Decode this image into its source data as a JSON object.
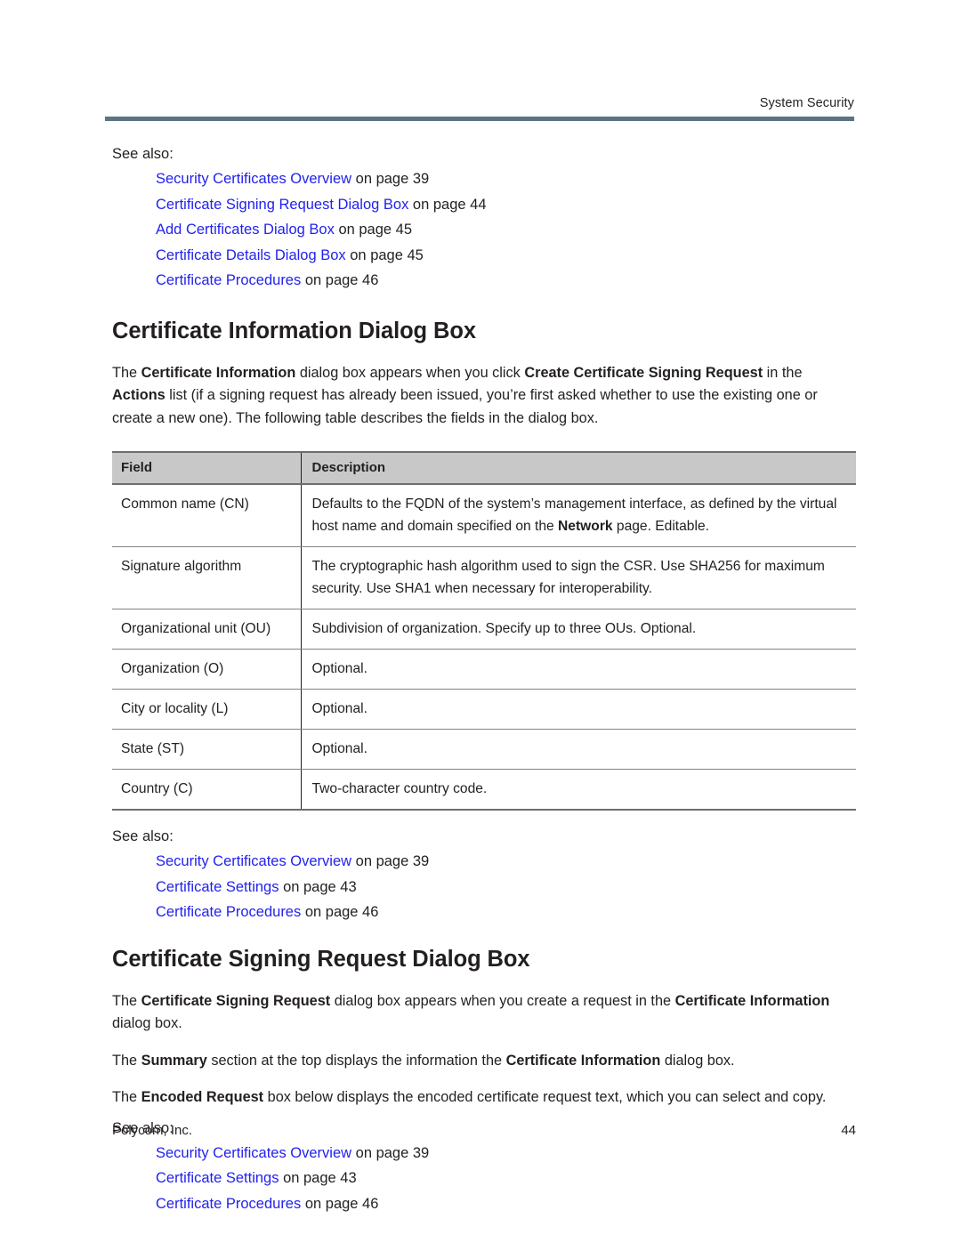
{
  "running_header": {
    "title": "System Security"
  },
  "see_also_1": {
    "label": "See also:",
    "items": [
      {
        "link": "Security Certificates Overview",
        "tail": " on page 39"
      },
      {
        "link": "Certificate Signing Request Dialog Box",
        "tail": " on page 44"
      },
      {
        "link": "Add Certificates Dialog Box",
        "tail": " on page 45"
      },
      {
        "link": "Certificate Details Dialog Box",
        "tail": " on page 45"
      },
      {
        "link": "Certificate Procedures",
        "tail": " on page 46"
      }
    ]
  },
  "section_1": {
    "heading": "Certificate Information Dialog Box",
    "intro": {
      "p1": "The ",
      "b1": "Certificate Information",
      "p2": " dialog box appears when you click ",
      "b2": "Create Certificate Signing Request",
      "p3": " in the ",
      "b3": "Actions",
      "p4": " list (if a signing request has already been issued, you’re first asked whether to use the existing one or create a new one). The following table describes the fields in the dialog box."
    }
  },
  "table": {
    "columns": [
      "Field",
      "Description"
    ],
    "rows": [
      {
        "field": "Common name (CN)",
        "desc_pre": "Defaults to the FQDN of the system’s management interface, as defined by the virtual host name and domain specified on the ",
        "desc_bold": "Network",
        "desc_post": " page. Editable."
      },
      {
        "field": "Signature algorithm",
        "desc_pre": "The cryptographic hash algorithm used to sign the CSR. Use SHA256 for maximum security. Use SHA1 when necessary for interoperability.",
        "desc_bold": "",
        "desc_post": ""
      },
      {
        "field": "Organizational unit (OU)",
        "desc_pre": "Subdivision of organization. Specify up to three OUs. Optional.",
        "desc_bold": "",
        "desc_post": ""
      },
      {
        "field": "Organization (O)",
        "desc_pre": "Optional.",
        "desc_bold": "",
        "desc_post": ""
      },
      {
        "field": "City or locality (L)",
        "desc_pre": "Optional.",
        "desc_bold": "",
        "desc_post": ""
      },
      {
        "field": "State (ST)",
        "desc_pre": "Optional.",
        "desc_bold": "",
        "desc_post": ""
      },
      {
        "field": "Country (C)",
        "desc_pre": "Two-character country code.",
        "desc_bold": "",
        "desc_post": ""
      }
    ]
  },
  "see_also_2": {
    "label": "See also:",
    "items": [
      {
        "link": "Security Certificates Overview",
        "tail": " on page 39"
      },
      {
        "link": "Certificate Settings",
        "tail": " on page 43"
      },
      {
        "link": "Certificate Procedures",
        "tail": " on page 46"
      }
    ]
  },
  "section_2": {
    "heading": "Certificate Signing Request Dialog Box",
    "para1": {
      "t1": "The ",
      "b1": "Certificate Signing Request",
      "t2": " dialog box appears when you create a request in the ",
      "b2": "Certificate Information",
      "t3": " dialog box."
    },
    "para2": {
      "t1": "The ",
      "b1": "Summary",
      "t2": " section at the top displays the information the ",
      "b2": "Certificate Information",
      "t3": " dialog box."
    },
    "para3": {
      "t1": "The ",
      "b1": "Encoded Request",
      "t2": " box below displays the encoded certificate request text, which you can select and copy."
    }
  },
  "see_also_3": {
    "label": "See also:",
    "items": [
      {
        "link": "Security Certificates Overview",
        "tail": " on page 39"
      },
      {
        "link": "Certificate Settings",
        "tail": " on page 43"
      },
      {
        "link": "Certificate Procedures",
        "tail": " on page 46"
      }
    ]
  },
  "footer": {
    "company": "Polycom, Inc.",
    "page_number": "44"
  },
  "colors": {
    "header_rule": "#5b7384",
    "link": "#2222ee",
    "table_header_bg": "#c8c8c8",
    "text": "#231f20"
  }
}
